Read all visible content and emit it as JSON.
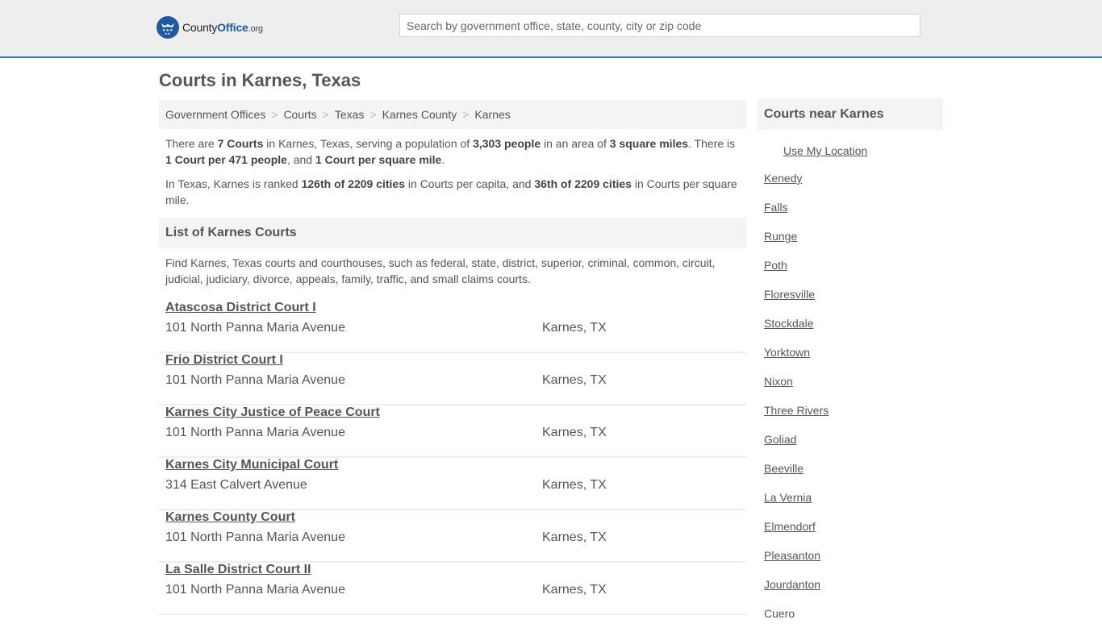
{
  "header": {
    "logo": {
      "text_main": "County",
      "text_brand": "Office",
      "text_tld": ".org",
      "icon": "eagle-stars-icon"
    },
    "search": {
      "placeholder": "Search by government office, state, county, city or zip code",
      "value": ""
    },
    "accent_color": "#337ab7"
  },
  "page_title": "Courts in Karnes, Texas",
  "breadcrumb": [
    "Government Offices",
    "Courts",
    "Texas",
    "Karnes County",
    "Karnes"
  ],
  "intro": {
    "p1": {
      "t1": "There are ",
      "b1": "7 Courts",
      "t2": " in Karnes, Texas, serving a population of ",
      "b2": "3,303 people",
      "t3": " in an area of ",
      "b3": "3 square miles",
      "t4": ". There is ",
      "b4": "1 Court per 471 people",
      "t5": ", and ",
      "b5": "1 Court per square mile",
      "t6": "."
    },
    "p2": {
      "t1": "In Texas, Karnes is ranked ",
      "b1": "126th of 2209 cities",
      "t2": " in Courts per capita, and ",
      "b2": "36th of 2209 cities",
      "t3": " in Courts per square mile."
    }
  },
  "list_section": {
    "title": "List of Karnes Courts",
    "description": "Find Karnes, Texas courts and courthouses, such as federal, state, district, superior, criminal, common, circuit, judicial, judiciary, divorce, appeals, family, traffic, and small claims courts.",
    "courts": [
      {
        "name": "Atascosa District Court I",
        "address": "101 North Panna Maria Avenue",
        "city": "Karnes, TX"
      },
      {
        "name": "Frio District Court I",
        "address": "101 North Panna Maria Avenue",
        "city": "Karnes, TX"
      },
      {
        "name": "Karnes City Justice of Peace Court",
        "address": "101 North Panna Maria Avenue",
        "city": "Karnes, TX"
      },
      {
        "name": "Karnes City Municipal Court",
        "address": "314 East Calvert Avenue",
        "city": "Karnes, TX"
      },
      {
        "name": "Karnes County Court",
        "address": "101 North Panna Maria Avenue",
        "city": "Karnes, TX"
      },
      {
        "name": "La Salle District Court II",
        "address": "101 North Panna Maria Avenue",
        "city": "Karnes, TX"
      }
    ]
  },
  "sidebar": {
    "title": "Courts near Karnes",
    "use_location": "Use My Location",
    "nearby": [
      "Kenedy",
      "Falls",
      "Runge",
      "Poth",
      "Floresville",
      "Stockdale",
      "Yorktown",
      "Nixon",
      "Three Rivers",
      "Goliad",
      "Beeville",
      "La Vernia",
      "Elmendorf",
      "Pleasanton",
      "Jourdanton",
      "Cuero"
    ]
  }
}
